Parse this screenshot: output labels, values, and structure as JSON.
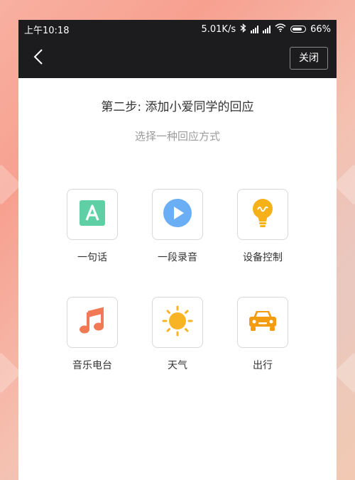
{
  "status_bar": {
    "time": "上午10:18",
    "speed": "5.01K/s",
    "battery": "66%"
  },
  "nav": {
    "close_label": "关闭"
  },
  "header": {
    "title": "第二步: 添加小爱同学的回应",
    "subtitle": "选择一种回应方式"
  },
  "options": [
    {
      "label": "一句话",
      "icon": "text-a-icon",
      "color": "#5fd0a6"
    },
    {
      "label": "一段录音",
      "icon": "play-circle-icon",
      "color": "#6aaef5"
    },
    {
      "label": "设备控制",
      "icon": "light-bulb-icon",
      "color": "#f5b117"
    },
    {
      "label": "音乐电台",
      "icon": "music-note-icon",
      "color": "#f07a55"
    },
    {
      "label": "天气",
      "icon": "sun-icon",
      "color": "#f8b425"
    },
    {
      "label": "出行",
      "icon": "car-icon",
      "color": "#f39c12"
    }
  ]
}
